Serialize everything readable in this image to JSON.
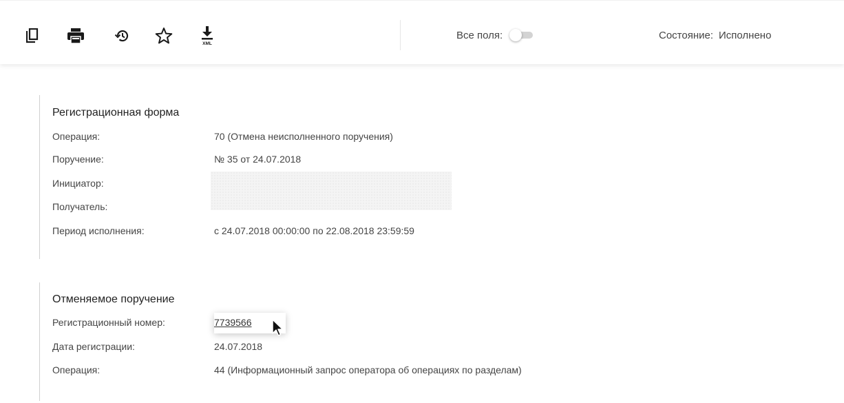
{
  "toolbar": {
    "icons": [
      "copy-icon",
      "print-icon",
      "history-icon",
      "star-icon",
      "download-xml-icon"
    ],
    "xml_caption": "XML",
    "all_fields_label": "Все поля:",
    "all_fields_enabled": false,
    "status_label": "Состояние:",
    "status_value": "Исполнено"
  },
  "registration_form": {
    "title": "Регистрационная форма",
    "rows": [
      {
        "label": "Операция:",
        "value": "70 (Отмена неисполненного поручения)"
      },
      {
        "label": "Поручение:",
        "value": "№ 35 от 24.07.2018"
      },
      {
        "label": "Инициатор:",
        "value": ""
      },
      {
        "label": "Получатель:",
        "value": ""
      },
      {
        "label": "Период исполнения:",
        "value": "с 24.07.2018 00:00:00 по 22.08.2018 23:59:59"
      }
    ]
  },
  "cancelled_order": {
    "title": "Отменяемое поручение",
    "rows": [
      {
        "label": "Регистрационный номер:",
        "value": "7739566"
      },
      {
        "label": "Дата регистрации:",
        "value": "24.07.2018"
      },
      {
        "label": "Операция:",
        "value": "44 (Информационный запрос оператора об операциях по разделам)"
      }
    ]
  },
  "colors": {
    "text": "#333333",
    "icon": "#1a1a1a",
    "divider": "#d0d0d0",
    "toggle_track": "#d3d3d3"
  }
}
